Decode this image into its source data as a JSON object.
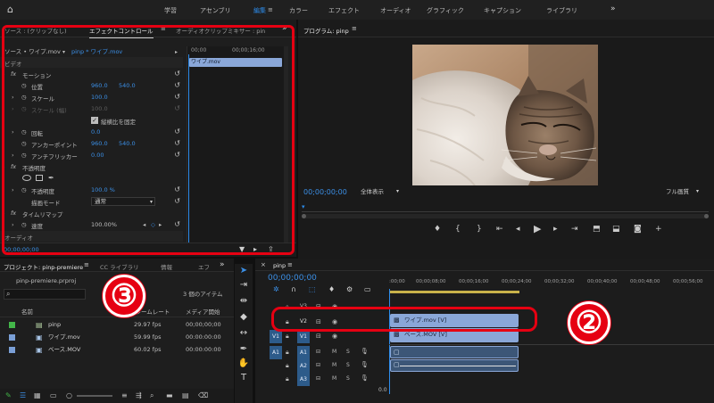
{
  "workspaces": [
    "学習",
    "アセンブリ",
    "編集",
    "カラー",
    "エフェクト",
    "オーディオ",
    "グラフィック",
    "キャプション",
    "ライブラリ"
  ],
  "effect_panel": {
    "tab_source": "ソース : (クリップなし)",
    "tab_effect": "エフェクトコントロール",
    "tab_mixer": "オーディオクリップミキサー : pin",
    "source_label": "ソース • ワイプ.mov",
    "seq_label": "pinp * ワイプ.mov",
    "time_a": "00;00",
    "time_b": "00;00;16;00",
    "clip_label": "ワイプ.mov",
    "section_video": "ビデオ",
    "motion": "モーション",
    "position": "位置",
    "position_x": "960.0",
    "position_y": "540.0",
    "scale": "スケール",
    "scale_value": "100.0",
    "scale_width": "スケール (幅)",
    "scale_width_value": "100.0",
    "uniform_scale": "縦横比を固定",
    "rotation": "回転",
    "rotation_value": "0.0",
    "anchor": "アンカーポイント",
    "anchor_x": "960.0",
    "anchor_y": "540.0",
    "flicker": "アンチフリッカー",
    "flicker_value": "0.00",
    "opacity": "不透明度",
    "opacity_param": "不透明度",
    "opacity_value": "100.0 %",
    "blend": "描画モード",
    "blend_value": "通常",
    "time_remap": "タイムリマップ",
    "speed": "速度",
    "speed_value": "100.00%",
    "section_audio": "オーディオ",
    "timecode": "00;00;00;00"
  },
  "program": {
    "title": "プログラム: pinp",
    "timecode": "00;00;00;00",
    "zoom": "全体表示",
    "quality": "フル画質"
  },
  "project": {
    "tab_project": "プロジェクト: pinp-premiere",
    "tab_library": "CC ライブラリ",
    "tab_info": "情報",
    "tab_effects": "エフ",
    "file": "pinp-premiere.prproj",
    "count": "3 個のアイテム",
    "col_name": "名前",
    "col_fps": "フレームレート",
    "col_start": "メディア開始",
    "items": [
      {
        "name": "pinp",
        "fps": "29.97 fps",
        "start": "00;00;00;00",
        "color": "#43b649"
      },
      {
        "name": "ワイプ.mov",
        "fps": "59.99 fps",
        "start": "00:00:00:00",
        "color": "#7a9fd6"
      },
      {
        "name": "ベース.MOV",
        "fps": "60.02 fps",
        "start": "00:00:00:00",
        "color": "#7a9fd6"
      }
    ]
  },
  "timeline": {
    "tab": "pinp",
    "timecode": "00;00;00;00",
    "ruler": [
      ":00;00",
      "00;00;08;00",
      "00;00;16;00",
      "00;00;24;00",
      "00;00;32;00",
      "00;00;40;00",
      "00;00;48;00",
      "00;00;56;00"
    ],
    "v3": "V3",
    "v2": "V2",
    "v1_src": "V1",
    "v1": "V1",
    "a1_src": "A1",
    "a1": "A1",
    "a2": "A2",
    "a3": "A3",
    "mix_value": "0.0",
    "clip_v2": "ワイプ.mov [V]",
    "clip_v1": "ベース.MOV [V]"
  },
  "badges": {
    "b2": "②",
    "b3": "③"
  },
  "colors": {
    "highlight": "#e60012",
    "accent": "#2d8ceb",
    "clip": "#8aa7d8"
  }
}
